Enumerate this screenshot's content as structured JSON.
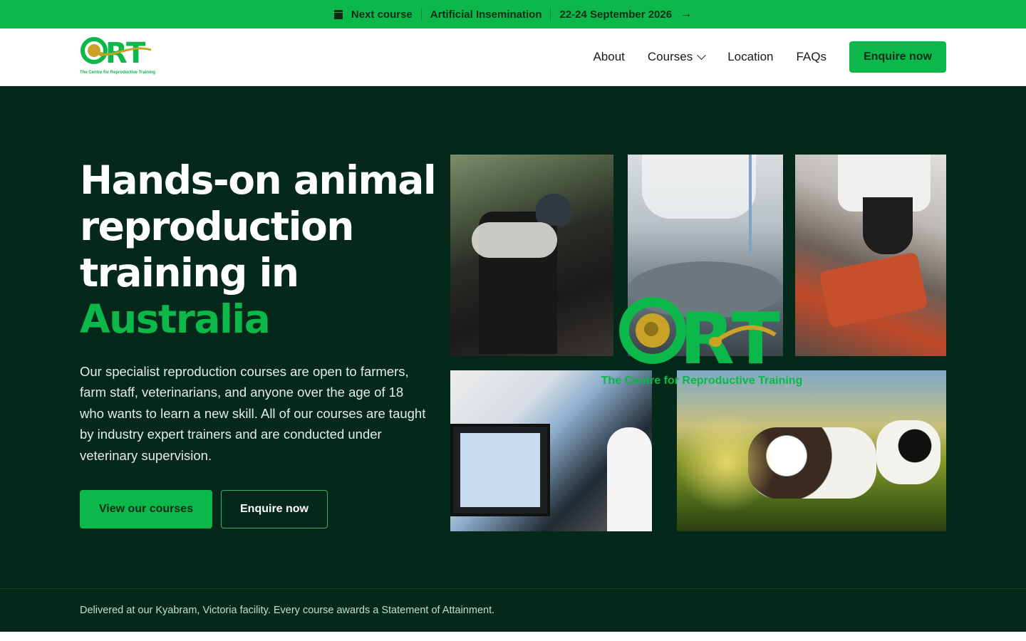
{
  "announcement": {
    "label": "Next course",
    "course": "Artificial Insemination",
    "dates": "22-24 September 2026",
    "arrow": "→"
  },
  "header": {
    "logo_text": "CRT",
    "logo_tagline": "The Centre for Reproductive Training",
    "nav": [
      {
        "label": "About"
      },
      {
        "label": "Courses"
      },
      {
        "label": "Location"
      },
      {
        "label": "FAQs"
      }
    ],
    "cta": "Enquire now"
  },
  "hero": {
    "title_line": "Hands-on animal reproduction training in",
    "title_accent": "Australia",
    "lead": "Our specialist reproduction courses are open to farmers, farm staff, veterinarians, and anyone over the age of 18 who wants to learn a new skill. All of our courses are taught by industry expert trainers and are conducted under veterinary supervision.",
    "primary_button": "View our courses",
    "secondary_button": "Enquire now"
  },
  "collage": {
    "brand_text": "CRT",
    "brand_tagline": "The Centre for Reproductive Training"
  },
  "footer_strip": {
    "text": "Delivered at our Kyabram, Victoria facility. Every course awards a Statement of Attainment."
  },
  "colors": {
    "brand_green": "#0cb84a",
    "hero_bg": "#04291a",
    "logo_gold": "#c9a227"
  },
  "icons": [
    "calendar-icon",
    "arrow-right-icon",
    "chevron-down-icon"
  ]
}
